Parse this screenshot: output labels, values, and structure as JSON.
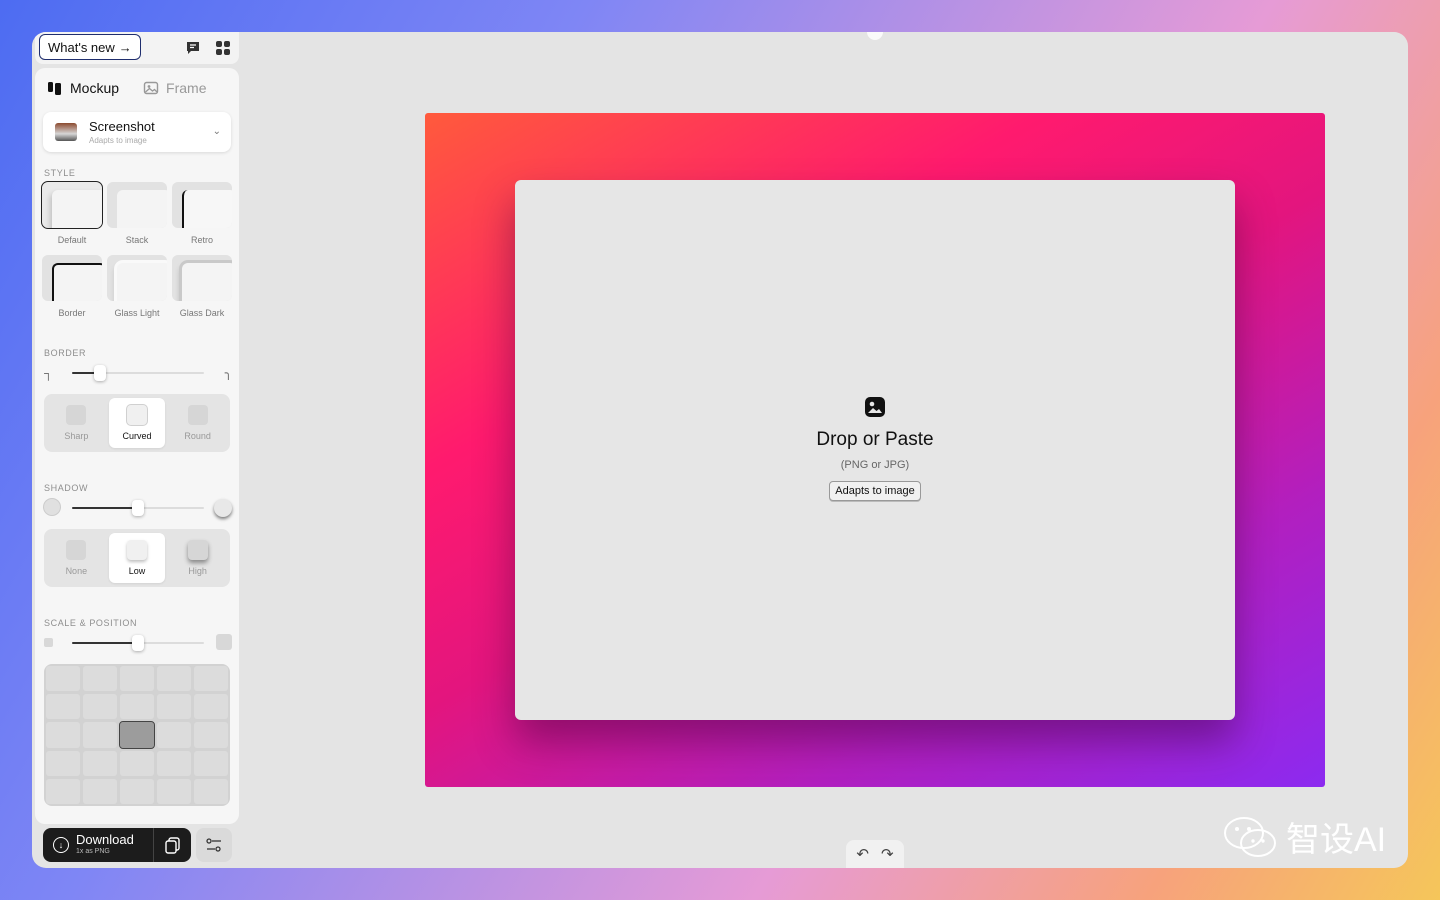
{
  "topbar": {
    "whats_new": "What's new",
    "arrow": "→",
    "icons": [
      "chat-icon",
      "grid-icon"
    ]
  },
  "tabs": [
    {
      "label": "Mockup",
      "icon": "mockup-icon",
      "active": true
    },
    {
      "label": "Frame",
      "icon": "image-icon",
      "active": false
    }
  ],
  "source": {
    "title": "Screenshot",
    "subtitle": "Adapts to image",
    "chevron": "⌄"
  },
  "sections": {
    "style": "STYLE",
    "border": "BORDER",
    "shadow": "SHADOW",
    "scale": "SCALE & POSITION"
  },
  "styles": [
    {
      "label": "Default",
      "selected": true
    },
    {
      "label": "Stack",
      "selected": false
    },
    {
      "label": "Retro",
      "selected": false
    },
    {
      "label": "Border",
      "selected": false
    },
    {
      "label": "Glass Light",
      "selected": false
    },
    {
      "label": "Glass Dark",
      "selected": false
    }
  ],
  "border_slider": {
    "value_fraction": 0.2
  },
  "border_options": [
    {
      "label": "Sharp",
      "active": false
    },
    {
      "label": "Curved",
      "active": true
    },
    {
      "label": "Round",
      "active": false
    }
  ],
  "shadow_slider": {
    "value_fraction": 0.5
  },
  "shadow_options": [
    {
      "label": "None",
      "active": false
    },
    {
      "label": "Low",
      "active": true
    },
    {
      "label": "High",
      "active": false
    }
  ],
  "scale_slider": {
    "value_fraction": 0.5
  },
  "position_grid": {
    "rows": 5,
    "cols": 5,
    "active_row": 2,
    "active_col": 2
  },
  "download": {
    "label": "Download",
    "sublabel": "1x as PNG"
  },
  "canvas": {
    "drop_title": "Drop or Paste",
    "drop_sub": "(PNG or JPG)",
    "pill": "Adapts to image",
    "frame_colors": [
      "#ff5a3c",
      "#ff1a6e",
      "#b21fbf",
      "#8c2af0"
    ]
  },
  "undo_redo": {
    "undo": "↶",
    "redo": "↷"
  },
  "watermark": {
    "text": "智设AI"
  }
}
